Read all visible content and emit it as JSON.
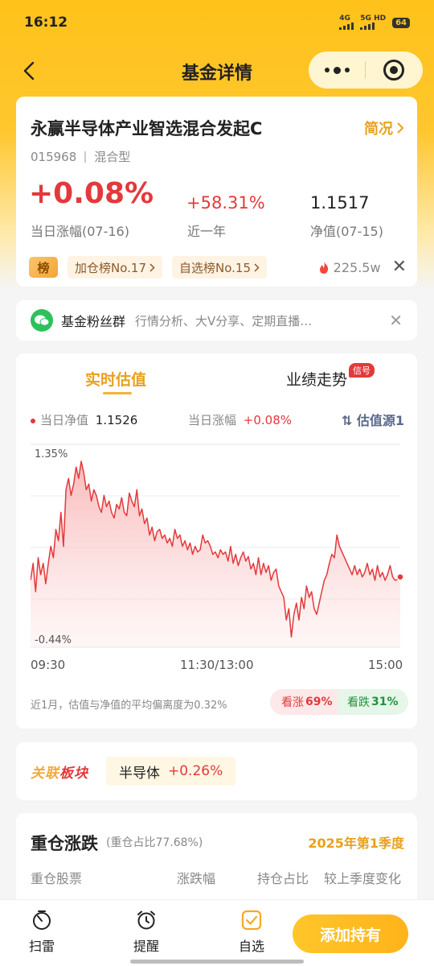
{
  "status": {
    "time": "16:12",
    "net1": "4G",
    "net2": "5G HD",
    "battery": "64"
  },
  "nav": {
    "title": "基金详情"
  },
  "fund": {
    "name": "永赢半导体产业智选混合发起C",
    "brief_link": "简况",
    "code": "015968",
    "type": "混合型",
    "day_change": "+0.08%",
    "day_change_label": "当日涨幅(07-16)",
    "year_change": "+58.31%",
    "year_label": "近一年",
    "nav_value": "1.1517",
    "nav_label": "净值(07-15)",
    "bang_icon_text": "榜",
    "tag1": "加仓榜No.17",
    "tag2": "自选榜No.15",
    "hot_count": "225.5w"
  },
  "group": {
    "title": "基金粉丝群",
    "desc": "行情分析、大V分享、定期直播…"
  },
  "chart_section": {
    "tab_active": "实时估值",
    "tab_inactive": "业绩走势",
    "tab_badge": "信号",
    "nav_label": "当日净值",
    "nav_value": "1.1526",
    "change_label": "当日涨幅",
    "change_value": "+0.08%",
    "source_link": "⇅ 估值源1",
    "time_start": "09:30",
    "time_mid": "11:30/13:00",
    "time_end": "15:00",
    "deviation_note": "近1月，估值与净值的平均偏离度为0.32%",
    "rise_label": "看涨",
    "rise_value": "69%",
    "fall_label": "看跌",
    "fall_value": "31%"
  },
  "chart_data": {
    "type": "area",
    "ylim": [
      -0.44,
      1.35
    ],
    "ytick_labels": [
      "1.35%",
      "-0.44%"
    ],
    "xtick_labels": [
      "09:30",
      "11:30/13:00",
      "15:00"
    ],
    "line_color": "#e3393c",
    "y": [
      0.15,
      0.3,
      0.05,
      0.35,
      0.2,
      0.3,
      0.12,
      0.3,
      0.45,
      0.35,
      0.6,
      0.5,
      0.75,
      0.45,
      0.95,
      1.05,
      0.9,
      1.0,
      1.15,
      1.05,
      1.2,
      1.1,
      0.95,
      1.0,
      0.85,
      0.95,
      0.9,
      0.8,
      0.75,
      0.9,
      0.8,
      0.85,
      0.75,
      0.7,
      0.82,
      0.78,
      0.88,
      0.75,
      0.72,
      0.92,
      0.85,
      0.8,
      0.95,
      0.72,
      0.78,
      0.65,
      0.7,
      0.55,
      0.62,
      0.5,
      0.58,
      0.6,
      0.52,
      0.55,
      0.48,
      0.52,
      0.45,
      0.6,
      0.52,
      0.55,
      0.45,
      0.5,
      0.42,
      0.48,
      0.38,
      0.45,
      0.4,
      0.42,
      0.55,
      0.48,
      0.5,
      0.45,
      0.38,
      0.4,
      0.35,
      0.42,
      0.38,
      0.4,
      0.32,
      0.45,
      0.3,
      0.38,
      0.28,
      0.35,
      0.4,
      0.32,
      0.36,
      0.25,
      0.3,
      0.2,
      0.35,
      0.2,
      0.3,
      0.22,
      0.28,
      0.15,
      0.22,
      0.25,
      0.1,
      0.05,
      0.0,
      -0.2,
      -0.1,
      -0.35,
      -0.15,
      -0.05,
      -0.2,
      0.0,
      -0.1,
      0.1,
      0.0,
      0.05,
      -0.1,
      -0.15,
      -0.05,
      0.05,
      0.15,
      0.2,
      0.3,
      0.38,
      0.35,
      0.55,
      0.45,
      0.4,
      0.35,
      0.3,
      0.25,
      0.2,
      0.28,
      0.2,
      0.25,
      0.18,
      0.22,
      0.3,
      0.2,
      0.25,
      0.15,
      0.28,
      0.18,
      0.22,
      0.15,
      0.2,
      0.28,
      0.18,
      0.15,
      0.16,
      0.18
    ]
  },
  "sector": {
    "logo_a": "关联",
    "logo_b": "板块",
    "name": "半导体",
    "change": "+0.26%"
  },
  "holdings": {
    "title": "重仓涨跌",
    "ratio": "(重仓占比77.68%)",
    "quarter": "2025年第1季度",
    "columns": [
      "重仓股票",
      "涨跌幅",
      "持仓占比",
      "较上季度变化"
    ]
  },
  "tabbar": {
    "item1": "扫雷",
    "item2": "提醒",
    "item3": "自选",
    "add_button": "添加持有"
  }
}
